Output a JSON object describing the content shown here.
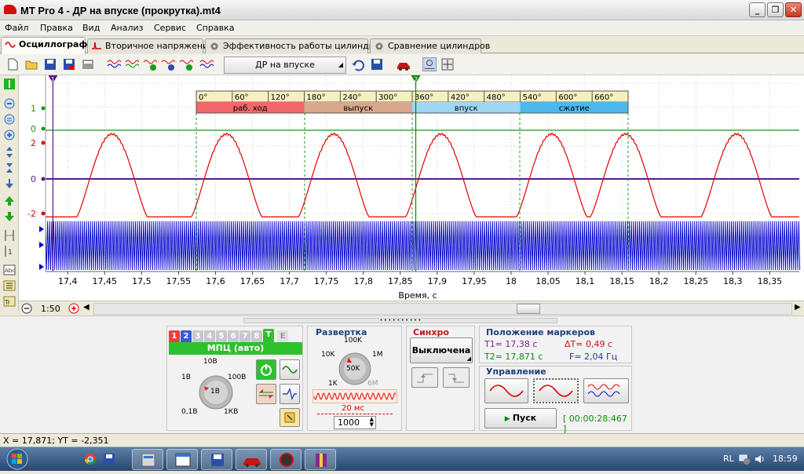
{
  "window": {
    "title": "MT Pro 4 - ДР на впуске (прокрутка).mt4"
  },
  "menu": [
    "Файл",
    "Правка",
    "Вид",
    "Анализ",
    "Сервис",
    "Справка"
  ],
  "tabs": [
    {
      "label": "Осциллограф",
      "active": true
    },
    {
      "label": "Вторичное напряжение"
    },
    {
      "label": "Эффективность работы цилиндров"
    },
    {
      "label": "Сравнение цилиндров"
    }
  ],
  "toolbar": {
    "preset": "ДР на впуске"
  },
  "chart_data": {
    "type": "line",
    "xlabel": "Время, с",
    "xlim": [
      17.37,
      18.39
    ],
    "x_ticks": [
      "17,4",
      "17,45",
      "17,5",
      "17,55",
      "17,6",
      "17,65",
      "17,7",
      "17,75",
      "17,8",
      "17,85",
      "17,9",
      "17,95",
      "18",
      "18,05",
      "18,1",
      "18,15",
      "18,2",
      "18,25",
      "18,3",
      "18,35"
    ],
    "y_ticks_green": [
      "1",
      "0"
    ],
    "y_ticks_red": [
      "2",
      "0",
      "-2"
    ],
    "marker_labels": [
      "1",
      "2"
    ],
    "markers_t": [
      17.38,
      17.871
    ],
    "degree_ticks": [
      "0°",
      "60°",
      "120°",
      "180°",
      "240°",
      "300°",
      "360°",
      "420°",
      "480°",
      "540°",
      "600°",
      "660°"
    ],
    "phases": [
      {
        "label": "раб. ход",
        "color": "#f06868"
      },
      {
        "label": "выпуск",
        "color": "#d9a78a"
      },
      {
        "label": "впуск",
        "color": "#9fd6f2"
      },
      {
        "label": "сжатие",
        "color": "#4eb8ec"
      }
    ],
    "series": [
      {
        "color": "#e00000",
        "peaks_t": [
          17.46,
          17.615,
          17.76,
          17.905,
          18.055,
          18.155,
          18.305
        ],
        "peak": 2.6,
        "trough": -2.2
      },
      {
        "color": "#1a9a1a"
      },
      {
        "color": "#5a1a8a"
      },
      {
        "color": "#0000cc"
      }
    ]
  },
  "timebase": {
    "zoom": "1:50"
  },
  "channels": {
    "tabs": [
      "1",
      "2",
      "3",
      "4",
      "5",
      "6",
      "7",
      "8",
      "T",
      "E"
    ],
    "mode": "МПЦ (авто)"
  },
  "voltage_knob": {
    "labels": [
      "10В",
      "1В",
      "100В",
      "0,1В",
      "1КВ"
    ],
    "value": "1В"
  },
  "sweep": {
    "title": "Развертка",
    "labels": [
      "100K",
      "10K",
      "1M",
      "1K",
      "6M"
    ],
    "value": "50K",
    "interval": "20 мс",
    "points": "1000"
  },
  "sync": {
    "title": "Синхро",
    "value": "Выключена"
  },
  "markers": {
    "title": "Положение маркеров",
    "t1": "T1= 17,38 с",
    "t2": "T2= 17,871 с",
    "dt": "ΔT= 0,49 с",
    "f": "F= 2,04 Гц"
  },
  "control": {
    "title": "Управление",
    "start": "Пуск",
    "timer": "[ 00:00:28:467 ]"
  },
  "status": {
    "text": "X = 17,871; YT = -2,351"
  },
  "taskbar": {
    "lang": "RL",
    "clock": "18:59"
  }
}
